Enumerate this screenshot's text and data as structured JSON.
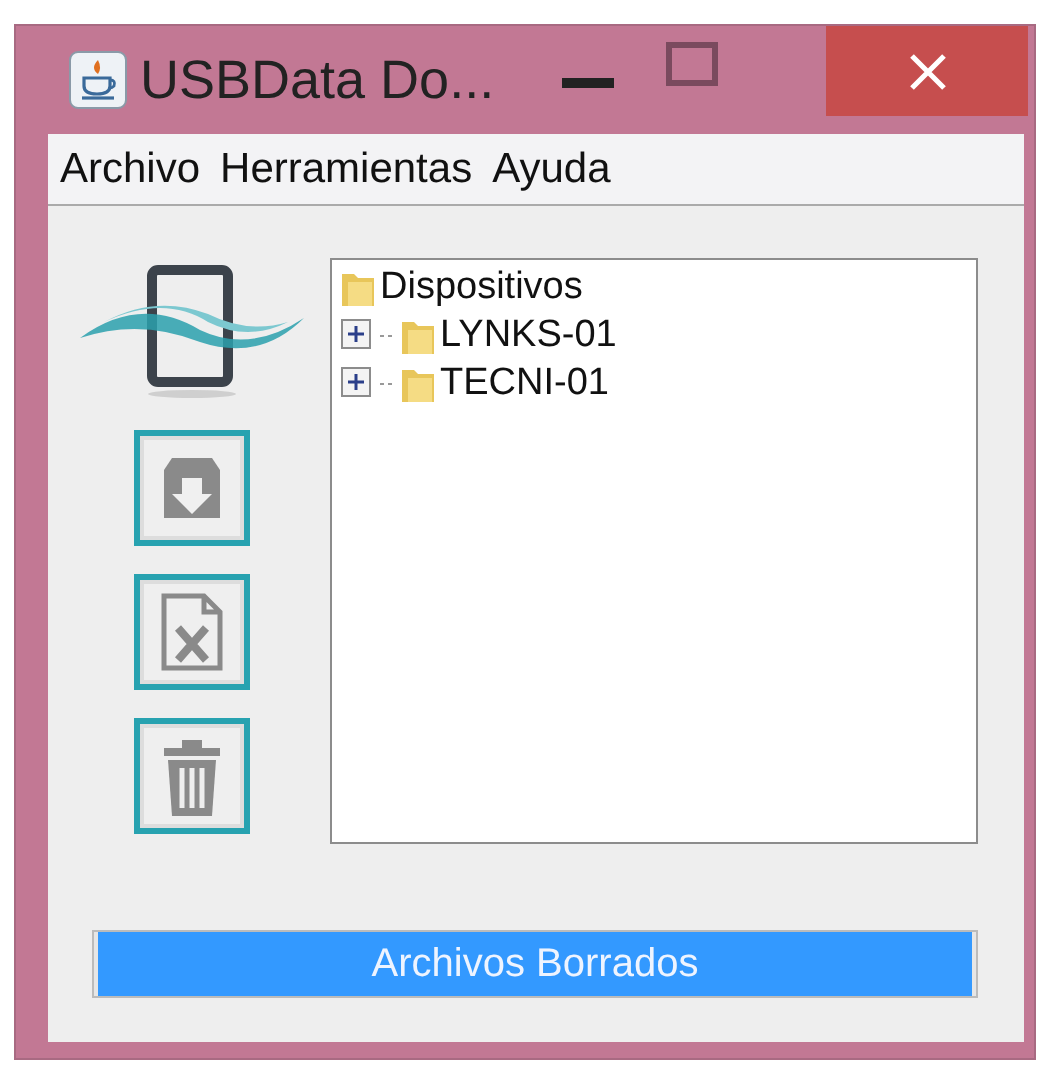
{
  "window": {
    "title": "USBData Do..."
  },
  "menu": [
    {
      "label": "Archivo"
    },
    {
      "label": "Herramientas"
    },
    {
      "label": "Ayuda"
    }
  ],
  "toolbar": [
    {
      "kind": "download"
    },
    {
      "kind": "excel"
    },
    {
      "kind": "delete"
    }
  ],
  "tree": {
    "label": "Dispositivos",
    "children": [
      {
        "label": "LYNKS-01",
        "expanded": false
      },
      {
        "label": "TECNI-01",
        "expanded": false
      }
    ]
  },
  "progress": {
    "label": "Archivos Borrados",
    "level": 1
  }
}
